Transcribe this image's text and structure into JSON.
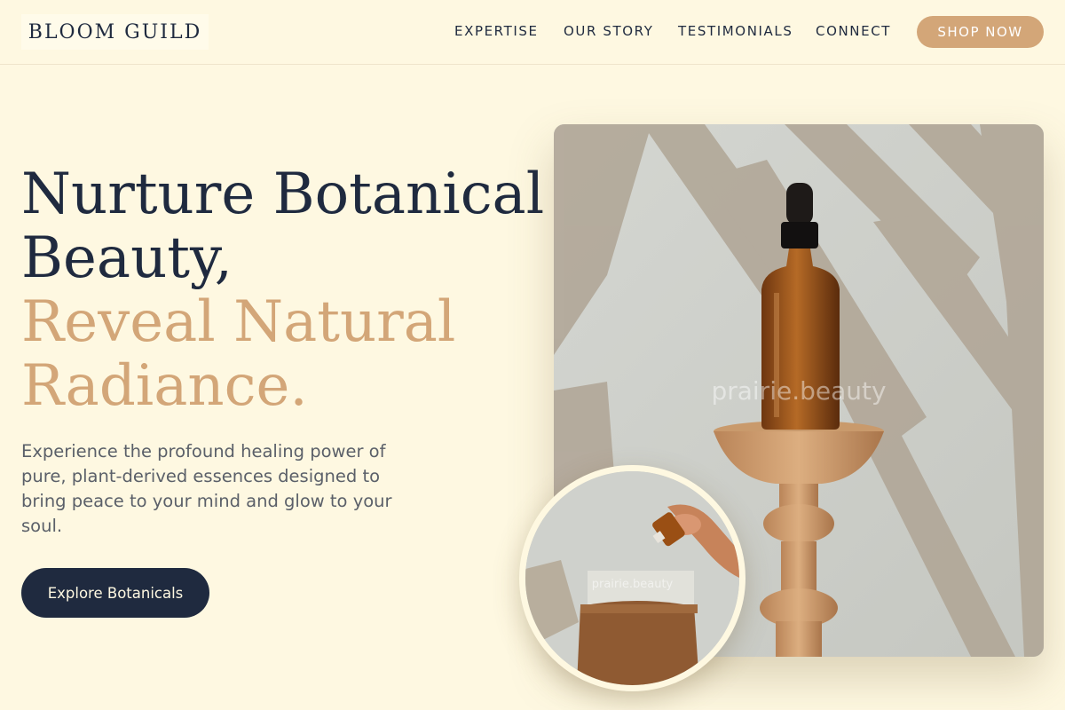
{
  "header": {
    "logo": "BLOOM GUILD",
    "nav": [
      "EXPERTISE",
      "OUR STORY",
      "TESTIMONIALS",
      "CONNECT"
    ],
    "shop_label": "SHOP NOW"
  },
  "hero": {
    "headline_line1": "Nurture Botanical",
    "headline_line2": "Beauty,",
    "headline_line3": "Reveal Natural",
    "headline_line4": "Radiance.",
    "subtext": "Experience the profound healing power of pure, plant-derived essences designed to bring peace to your mind and glow to your soul.",
    "cta_label": "Explore Botanicals"
  },
  "images": {
    "main_watermark": "prairie.beauty",
    "circle_watermark": "prairie.beauty"
  },
  "colors": {
    "background": "#fef8e1",
    "navy": "#1f2a3f",
    "accent": "#d3a678"
  }
}
